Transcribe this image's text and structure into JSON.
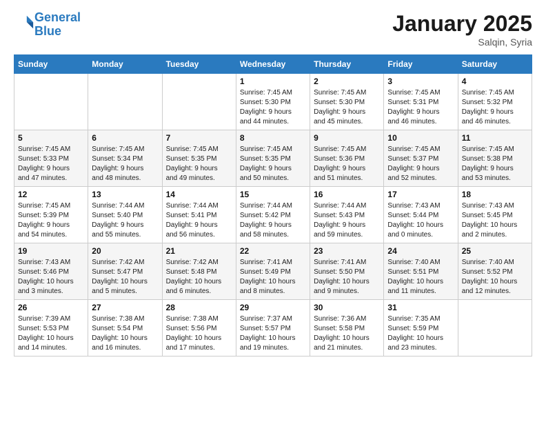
{
  "header": {
    "logo_line1": "General",
    "logo_line2": "Blue",
    "month": "January 2025",
    "location": "Salqin, Syria"
  },
  "days_of_week": [
    "Sunday",
    "Monday",
    "Tuesday",
    "Wednesday",
    "Thursday",
    "Friday",
    "Saturday"
  ],
  "weeks": [
    [
      {
        "num": "",
        "info": ""
      },
      {
        "num": "",
        "info": ""
      },
      {
        "num": "",
        "info": ""
      },
      {
        "num": "1",
        "info": "Sunrise: 7:45 AM\nSunset: 5:30 PM\nDaylight: 9 hours\nand 44 minutes."
      },
      {
        "num": "2",
        "info": "Sunrise: 7:45 AM\nSunset: 5:30 PM\nDaylight: 9 hours\nand 45 minutes."
      },
      {
        "num": "3",
        "info": "Sunrise: 7:45 AM\nSunset: 5:31 PM\nDaylight: 9 hours\nand 46 minutes."
      },
      {
        "num": "4",
        "info": "Sunrise: 7:45 AM\nSunset: 5:32 PM\nDaylight: 9 hours\nand 46 minutes."
      }
    ],
    [
      {
        "num": "5",
        "info": "Sunrise: 7:45 AM\nSunset: 5:33 PM\nDaylight: 9 hours\nand 47 minutes."
      },
      {
        "num": "6",
        "info": "Sunrise: 7:45 AM\nSunset: 5:34 PM\nDaylight: 9 hours\nand 48 minutes."
      },
      {
        "num": "7",
        "info": "Sunrise: 7:45 AM\nSunset: 5:35 PM\nDaylight: 9 hours\nand 49 minutes."
      },
      {
        "num": "8",
        "info": "Sunrise: 7:45 AM\nSunset: 5:35 PM\nDaylight: 9 hours\nand 50 minutes."
      },
      {
        "num": "9",
        "info": "Sunrise: 7:45 AM\nSunset: 5:36 PM\nDaylight: 9 hours\nand 51 minutes."
      },
      {
        "num": "10",
        "info": "Sunrise: 7:45 AM\nSunset: 5:37 PM\nDaylight: 9 hours\nand 52 minutes."
      },
      {
        "num": "11",
        "info": "Sunrise: 7:45 AM\nSunset: 5:38 PM\nDaylight: 9 hours\nand 53 minutes."
      }
    ],
    [
      {
        "num": "12",
        "info": "Sunrise: 7:45 AM\nSunset: 5:39 PM\nDaylight: 9 hours\nand 54 minutes."
      },
      {
        "num": "13",
        "info": "Sunrise: 7:44 AM\nSunset: 5:40 PM\nDaylight: 9 hours\nand 55 minutes."
      },
      {
        "num": "14",
        "info": "Sunrise: 7:44 AM\nSunset: 5:41 PM\nDaylight: 9 hours\nand 56 minutes."
      },
      {
        "num": "15",
        "info": "Sunrise: 7:44 AM\nSunset: 5:42 PM\nDaylight: 9 hours\nand 58 minutes."
      },
      {
        "num": "16",
        "info": "Sunrise: 7:44 AM\nSunset: 5:43 PM\nDaylight: 9 hours\nand 59 minutes."
      },
      {
        "num": "17",
        "info": "Sunrise: 7:43 AM\nSunset: 5:44 PM\nDaylight: 10 hours\nand 0 minutes."
      },
      {
        "num": "18",
        "info": "Sunrise: 7:43 AM\nSunset: 5:45 PM\nDaylight: 10 hours\nand 2 minutes."
      }
    ],
    [
      {
        "num": "19",
        "info": "Sunrise: 7:43 AM\nSunset: 5:46 PM\nDaylight: 10 hours\nand 3 minutes."
      },
      {
        "num": "20",
        "info": "Sunrise: 7:42 AM\nSunset: 5:47 PM\nDaylight: 10 hours\nand 5 minutes."
      },
      {
        "num": "21",
        "info": "Sunrise: 7:42 AM\nSunset: 5:48 PM\nDaylight: 10 hours\nand 6 minutes."
      },
      {
        "num": "22",
        "info": "Sunrise: 7:41 AM\nSunset: 5:49 PM\nDaylight: 10 hours\nand 8 minutes."
      },
      {
        "num": "23",
        "info": "Sunrise: 7:41 AM\nSunset: 5:50 PM\nDaylight: 10 hours\nand 9 minutes."
      },
      {
        "num": "24",
        "info": "Sunrise: 7:40 AM\nSunset: 5:51 PM\nDaylight: 10 hours\nand 11 minutes."
      },
      {
        "num": "25",
        "info": "Sunrise: 7:40 AM\nSunset: 5:52 PM\nDaylight: 10 hours\nand 12 minutes."
      }
    ],
    [
      {
        "num": "26",
        "info": "Sunrise: 7:39 AM\nSunset: 5:53 PM\nDaylight: 10 hours\nand 14 minutes."
      },
      {
        "num": "27",
        "info": "Sunrise: 7:38 AM\nSunset: 5:54 PM\nDaylight: 10 hours\nand 16 minutes."
      },
      {
        "num": "28",
        "info": "Sunrise: 7:38 AM\nSunset: 5:56 PM\nDaylight: 10 hours\nand 17 minutes."
      },
      {
        "num": "29",
        "info": "Sunrise: 7:37 AM\nSunset: 5:57 PM\nDaylight: 10 hours\nand 19 minutes."
      },
      {
        "num": "30",
        "info": "Sunrise: 7:36 AM\nSunset: 5:58 PM\nDaylight: 10 hours\nand 21 minutes."
      },
      {
        "num": "31",
        "info": "Sunrise: 7:35 AM\nSunset: 5:59 PM\nDaylight: 10 hours\nand 23 minutes."
      },
      {
        "num": "",
        "info": ""
      }
    ]
  ]
}
